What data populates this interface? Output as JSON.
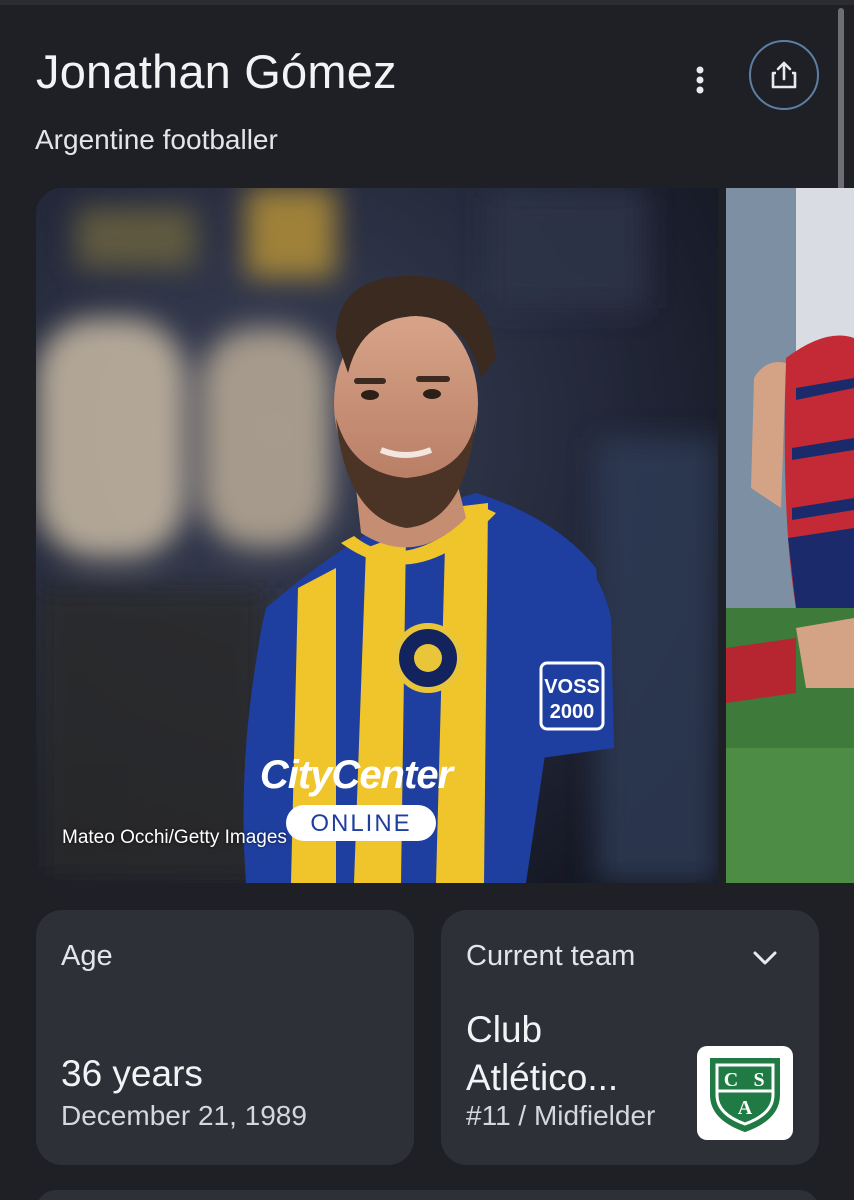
{
  "header": {
    "title": "Jonathan Gómez",
    "subtitle": "Argentine footballer",
    "more_icon": "more-vert-icon",
    "share_icon": "share-icon"
  },
  "gallery": {
    "credit": "Mateo Occhi/Getty Images",
    "jersey_sponsor": "CityCenter",
    "jersey_sponsor_sub": "ONLINE",
    "sleeve_sponsor": "VOSS 2000"
  },
  "age_card": {
    "label": "Age",
    "value": "36 years",
    "date": "December 21, 1989"
  },
  "team_card": {
    "label": "Current team",
    "name": "Club Atlético...",
    "role": "#11 / Midfielder",
    "crest_letters": [
      "C",
      "S",
      "A"
    ],
    "chevron_icon": "chevron-down-icon"
  },
  "colors": {
    "background": "#1f2025",
    "card": "#2e3038",
    "accent_ring": "#5c7fa6",
    "crest_green": "#1f7a44"
  }
}
